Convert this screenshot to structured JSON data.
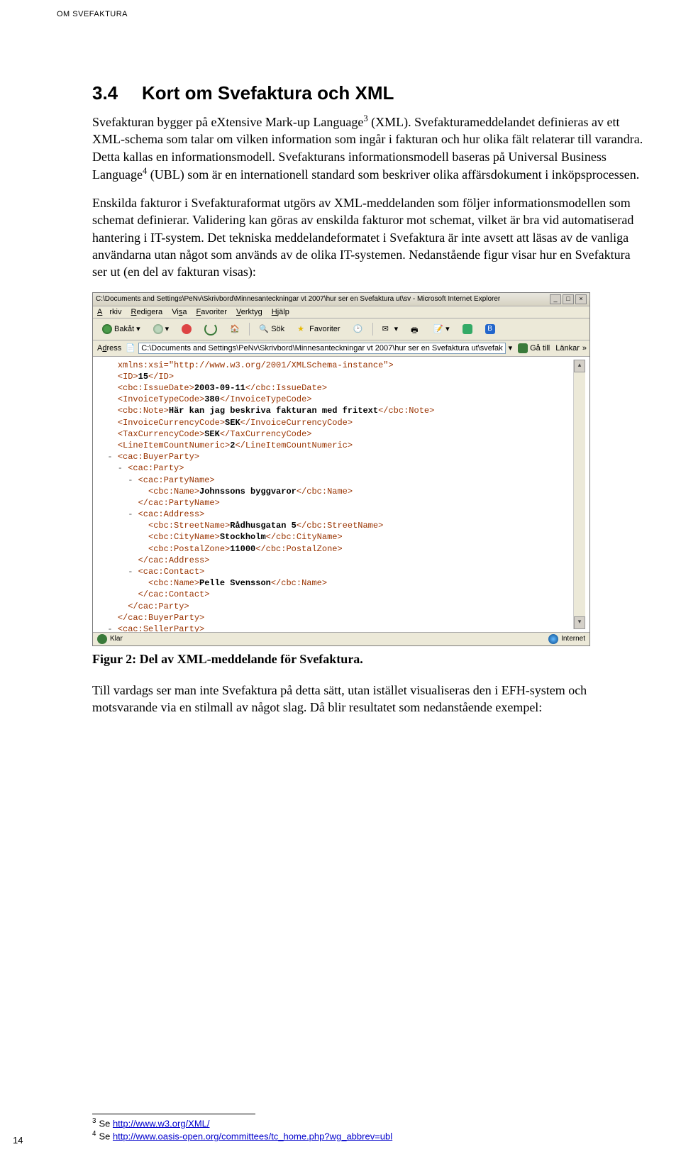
{
  "header": {
    "running_head": "OM SVEFAKTURA"
  },
  "section": {
    "number": "3.4",
    "title": "Kort om Svefaktura och XML"
  },
  "paragraphs": {
    "p1a": "Svefakturan bygger på eXtensive Mark-up Language",
    "p1_fn3": "3",
    "p1b": " (XML). Svefakturameddelandet definieras av ett XML-schema som talar om vilken information som ingår i fakturan och hur olika fält relaterar till varandra. Detta kallas en informationsmodell. Svefakturans informationsmodell baseras på Universal Business Language",
    "p1_fn4": "4",
    "p1c": " (UBL) som är en internationell standard som beskriver olika affärsdokument i inköpsprocessen.",
    "p2": "Enskilda fakturor i Svefakturaformat utgörs av XML-meddelanden som följer informationsmodellen som schemat definierar. Validering kan göras av enskilda fakturor mot schemat, vilket är bra vid automatiserad hantering i IT-system. Det tekniska meddelandeformatet i Svefaktura är inte avsett att läsas av de vanliga användarna utan något som används av de olika IT-systemen. Nedanstående figur visar hur en Svefaktura ser ut (en del av fakturan visas):",
    "caption": "Figur 2: Del av XML-meddelande för Svefaktura.",
    "p3": "Till vardags ser man inte Svefaktura på detta sätt, utan istället visualiseras den i EFH-system och motsvarande via en stilmall av något slag. Då blir resultatet som nedanstående exempel:"
  },
  "browser": {
    "title": "C:\\Documents and Settings\\PeNv\\Skrivbord\\Minnesanteckningar vt 2007\\hur ser en Svefaktura ut\\sv - Microsoft Internet Explorer",
    "menus": {
      "arkiv": "Arkiv",
      "redigera": "Redigera",
      "visa": "Visa",
      "favoriter": "Favoriter",
      "verktyg": "Verktyg",
      "hjalp": "Hjälp"
    },
    "toolbar": {
      "back": "Bakåt",
      "search": "Sök",
      "favorites": "Favoriter"
    },
    "address_label": "Adress",
    "address_value": "C:\\Documents and Settings\\PeNv\\Skrivbord\\Minnesanteckningar vt 2007\\hur ser en Svefaktura ut\\svefaktura.xml",
    "go": "Gå till",
    "links": "Länkar",
    "status_left": "Klar",
    "status_right": "Internet",
    "xml": {
      "l0_head": "xmlns:xsi=\"http://www.w3.org/2001/XMLSchema-instance\">",
      "l1": {
        "o": "<ID>",
        "v": "15",
        "c": "</ID>"
      },
      "l2": {
        "o": "<cbc:IssueDate>",
        "v": "2003-09-11",
        "c": "</cbc:IssueDate>"
      },
      "l3": {
        "o": "<InvoiceTypeCode>",
        "v": "380",
        "c": "</InvoiceTypeCode>"
      },
      "l4": {
        "o": "<cbc:Note>",
        "v": "Här kan jag beskriva fakturan med fritext",
        "c": "</cbc:Note>"
      },
      "l5": {
        "o": "<InvoiceCurrencyCode>",
        "v": "SEK",
        "c": "</InvoiceCurrencyCode>"
      },
      "l6": {
        "o": "<TaxCurrencyCode>",
        "v": "SEK",
        "c": "</TaxCurrencyCode>"
      },
      "l7": {
        "o": "<LineItemCountNumeric>",
        "v": "2",
        "c": "</LineItemCountNumeric>"
      },
      "l8": "<cac:BuyerParty>",
      "l9": "<cac:Party>",
      "l10": "<cac:PartyName>",
      "l11": {
        "o": "<cbc:Name>",
        "v": "Johnssons byggvaror",
        "c": "</cbc:Name>"
      },
      "l12": "</cac:PartyName>",
      "l13": "<cac:Address>",
      "l14": {
        "o": "<cbc:StreetName>",
        "v": "Rådhusgatan 5",
        "c": "</cbc:StreetName>"
      },
      "l15": {
        "o": "<cbc:CityName>",
        "v": "Stockholm",
        "c": "</cbc:CityName>"
      },
      "l16": {
        "o": "<cbc:PostalZone>",
        "v": "11000",
        "c": "</cbc:PostalZone>"
      },
      "l17": "</cac:Address>",
      "l18": "<cac:Contact>",
      "l19": {
        "o": "<cbc:Name>",
        "v": "Pelle Svensson",
        "c": "</cbc:Name>"
      },
      "l20": "</cac:Contact>",
      "l21": "</cac:Party>",
      "l22": "</cac:BuyerParty>",
      "l23": "<cac:SellerParty>"
    }
  },
  "footnotes": {
    "f3_pre": "Se ",
    "f3_link": "http://www.w3.org/XML/",
    "f4_pre": "Se ",
    "f4_link": "http://www.oasis-open.org/committees/tc_home.php?wg_abbrev=ubl"
  },
  "page_number": "14"
}
